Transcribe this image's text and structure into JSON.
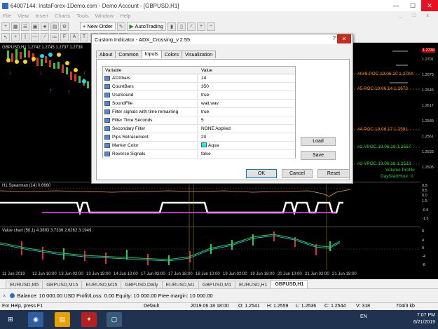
{
  "window": {
    "title": "64007144: InstaForex-1Demo.com - Demo Account - [GBPUSD,H1]",
    "min": "—",
    "max": "☐",
    "close": "✕"
  },
  "menu": [
    "File",
    "View",
    "Insert",
    "Charts",
    "Tools",
    "Window",
    "Help"
  ],
  "toolbar": {
    "new_order": "New Order",
    "autotrading": "AutoTrading"
  },
  "chart": {
    "info": "GBPUSD,H1  1.2742 1.2745 1.2737 1.2739",
    "current_price": "1.2739",
    "poc_labels": [
      "#0#9 POC 19.06.20 1.2704",
      "#5 POC 19.06.14 1.2673",
      "#4 POC 19.06.17 1.2591",
      "#2 VPOC 19.06.19 1.2557",
      "#3 VPOC 19.06.18 1.2523"
    ],
    "volume_profile": "Volume Profile",
    "day_start_hour": "DayStartHour: 0",
    "price_scale": [
      "1.2729",
      "1.2701",
      "1.2673",
      "1.2645",
      "1.2617",
      "1.2589",
      "1.2561",
      "1.2533",
      "1.2505"
    ],
    "sub1_info": "H1 Spearman (14) 0.6660",
    "sub1_scale": [
      "0.8",
      "0.5",
      "0.0",
      "1.5",
      "-0.5",
      "-1.5"
    ],
    "sub2_info": "Value chart (50,1) 4.3893 3.7336 2.6262 3.1949",
    "sub2_scale": [
      "8",
      "4",
      "0",
      "-4",
      "-8"
    ],
    "time_labels": [
      "11 Jun 2019",
      "12 Jun 10:00",
      "13 Jun 02:00",
      "13 Jun 18:00",
      "14 Jun 10:00",
      "17 Jun 02:00",
      "17 Jun 18:00",
      "18 Jun 10:00",
      "19 Jun 02:00",
      "19 Jun 18:00",
      "20 Jun 10:00",
      "21 Jun 02:00",
      "21 Jun 18:00"
    ]
  },
  "symbol_tabs": [
    "EURUSD,M5",
    "GBPUSD,M15",
    "EURUSD,M15",
    "GBPUSD,Daily",
    "EURUSD,M1",
    "GBPUSD,M1",
    "EURUSD,H1",
    "GBPUSD,H1"
  ],
  "terminal": {
    "balance": "Balance: 10 000.00 USD  Profit/Loss: 0.00  Equity: 10 000.00  Free margin: 10 000.00"
  },
  "status": {
    "help": "For Help, press F1",
    "profile": "Default",
    "datetime": "2019.06.18 18:00",
    "open": "O: 1.2541",
    "high": "H: 1.2559",
    "low": "L: 1.2536",
    "close": "C: 1.2544",
    "volume": "V: 318",
    "traffic": "704/3 kb"
  },
  "taskbar": {
    "lang": "EN",
    "time": "7:07 PM",
    "date": "6/21/2019"
  },
  "dialog": {
    "title": "Custom Indicator - ADX_Crossing_v.2.55",
    "help": "?",
    "close": "✕",
    "tabs": [
      "About",
      "Common",
      "Inputs",
      "Colors",
      "Visualization"
    ],
    "col_variable": "Variable",
    "col_value": "Value",
    "inputs": [
      {
        "name": "ADXbars",
        "value": "14"
      },
      {
        "name": "CountBars",
        "value": "350"
      },
      {
        "name": "UseSound",
        "value": "true"
      },
      {
        "name": "SoundFile",
        "value": "wait.wav"
      },
      {
        "name": "Filter signals with time remaining",
        "value": "true"
      },
      {
        "name": "Filter Time Seconds",
        "value": "5"
      },
      {
        "name": "Secondary Filter",
        "value": "NONE Applied"
      },
      {
        "name": "Pips Retracement",
        "value": "20"
      },
      {
        "name": "Marker Color",
        "value": "Aqua"
      },
      {
        "name": "Reverse Signals",
        "value": "false"
      }
    ],
    "marker_color_hex": "#00ffff",
    "load": "Load",
    "save": "Save",
    "ok": "OK",
    "cancel": "Cancel",
    "reset": "Reset"
  }
}
